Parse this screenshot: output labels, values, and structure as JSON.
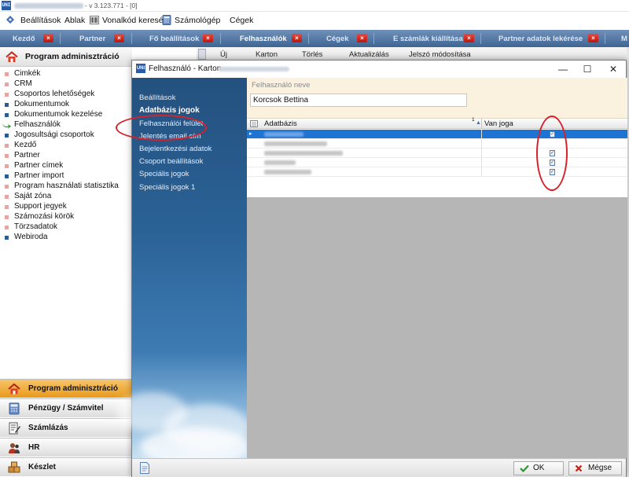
{
  "app": {
    "logo_text": "UNI",
    "version": "- v 3.123.771 - [0]"
  },
  "menu": {
    "items": [
      {
        "label": "Beállítások",
        "icon": "settings-icon"
      },
      {
        "label": "Ablak",
        "icon": ""
      },
      {
        "label": "Vonalkód keresés",
        "icon": "barcode-icon"
      },
      {
        "label": "Számológép",
        "icon": "calculator-icon"
      },
      {
        "label": "Cégek",
        "icon": ""
      }
    ]
  },
  "tabs": [
    {
      "label": "Kezdő",
      "active": false
    },
    {
      "label": "Partner",
      "active": false
    },
    {
      "label": "Fő beállítások",
      "active": false
    },
    {
      "label": "Felhasználók",
      "active": true
    },
    {
      "label": "Cégek",
      "active": false
    },
    {
      "label": "E számlák kiállítása",
      "active": false
    },
    {
      "label": "Partner adatok lekérése",
      "active": false
    },
    {
      "label": "M",
      "active": false
    }
  ],
  "left_panel": {
    "title": "Program adminisztráció",
    "items": [
      "Cimkék",
      "CRM",
      "Csoportos lehetőségek",
      "Dokumentumok",
      "Dokumentumok kezelése",
      "Felhasználók",
      "Jogosultsági csoportok",
      "Kezdő",
      "Partner",
      "Partner címek",
      "Partner import",
      "Program használati statisztika",
      "Saját zóna",
      "Support jegyek",
      "Számozási körök",
      "Törzsadatok",
      "Webiroda"
    ],
    "modules": [
      {
        "label": "Program adminisztráció",
        "active": true
      },
      {
        "label": "Pénzügy / Számvitel",
        "active": false
      },
      {
        "label": "Számlázás",
        "active": false
      },
      {
        "label": "HR",
        "active": false
      },
      {
        "label": "Készlet",
        "active": false
      }
    ]
  },
  "background_toolbar": {
    "items": [
      "Új",
      "Karton",
      "Törlés",
      "Aktualizálás",
      "Jelszó módosítása"
    ]
  },
  "dialog": {
    "title": "Felhasználó - Karton",
    "logo_text": "UNI",
    "minimize": "—",
    "maximize": "☐",
    "close": "✕",
    "nav": [
      {
        "label": "Beállítások",
        "selected": false
      },
      {
        "label": "Adatbázis jogok",
        "selected": true
      },
      {
        "label": "Felhasználói felület",
        "selected": false
      },
      {
        "label": "Jelentés email cím",
        "selected": false
      },
      {
        "label": "Bejelentkezési adatok",
        "selected": false
      },
      {
        "label": "Csoport beállítások",
        "selected": false
      },
      {
        "label": "Speciális jogok",
        "selected": false
      },
      {
        "label": "Speciális jogok 1",
        "selected": false
      }
    ],
    "field_label": "Felhasználó neve",
    "field_value": "Korcsok Bettina",
    "grid": {
      "columns": [
        "Adatbázis",
        "Van joga"
      ],
      "sort_indicator": "1",
      "rows": [
        {
          "checked": true,
          "selected": true
        },
        {
          "checked": false,
          "selected": false
        },
        {
          "checked": true,
          "selected": false
        },
        {
          "checked": true,
          "selected": false
        },
        {
          "checked": true,
          "selected": false
        }
      ]
    },
    "ok_label": "OK",
    "cancel_label": "Mégse",
    "colors": {
      "nav_top": "#24517f",
      "selection": "#1e74d2",
      "annotation": "#d8212b",
      "module_active": "#e79a1c"
    }
  }
}
